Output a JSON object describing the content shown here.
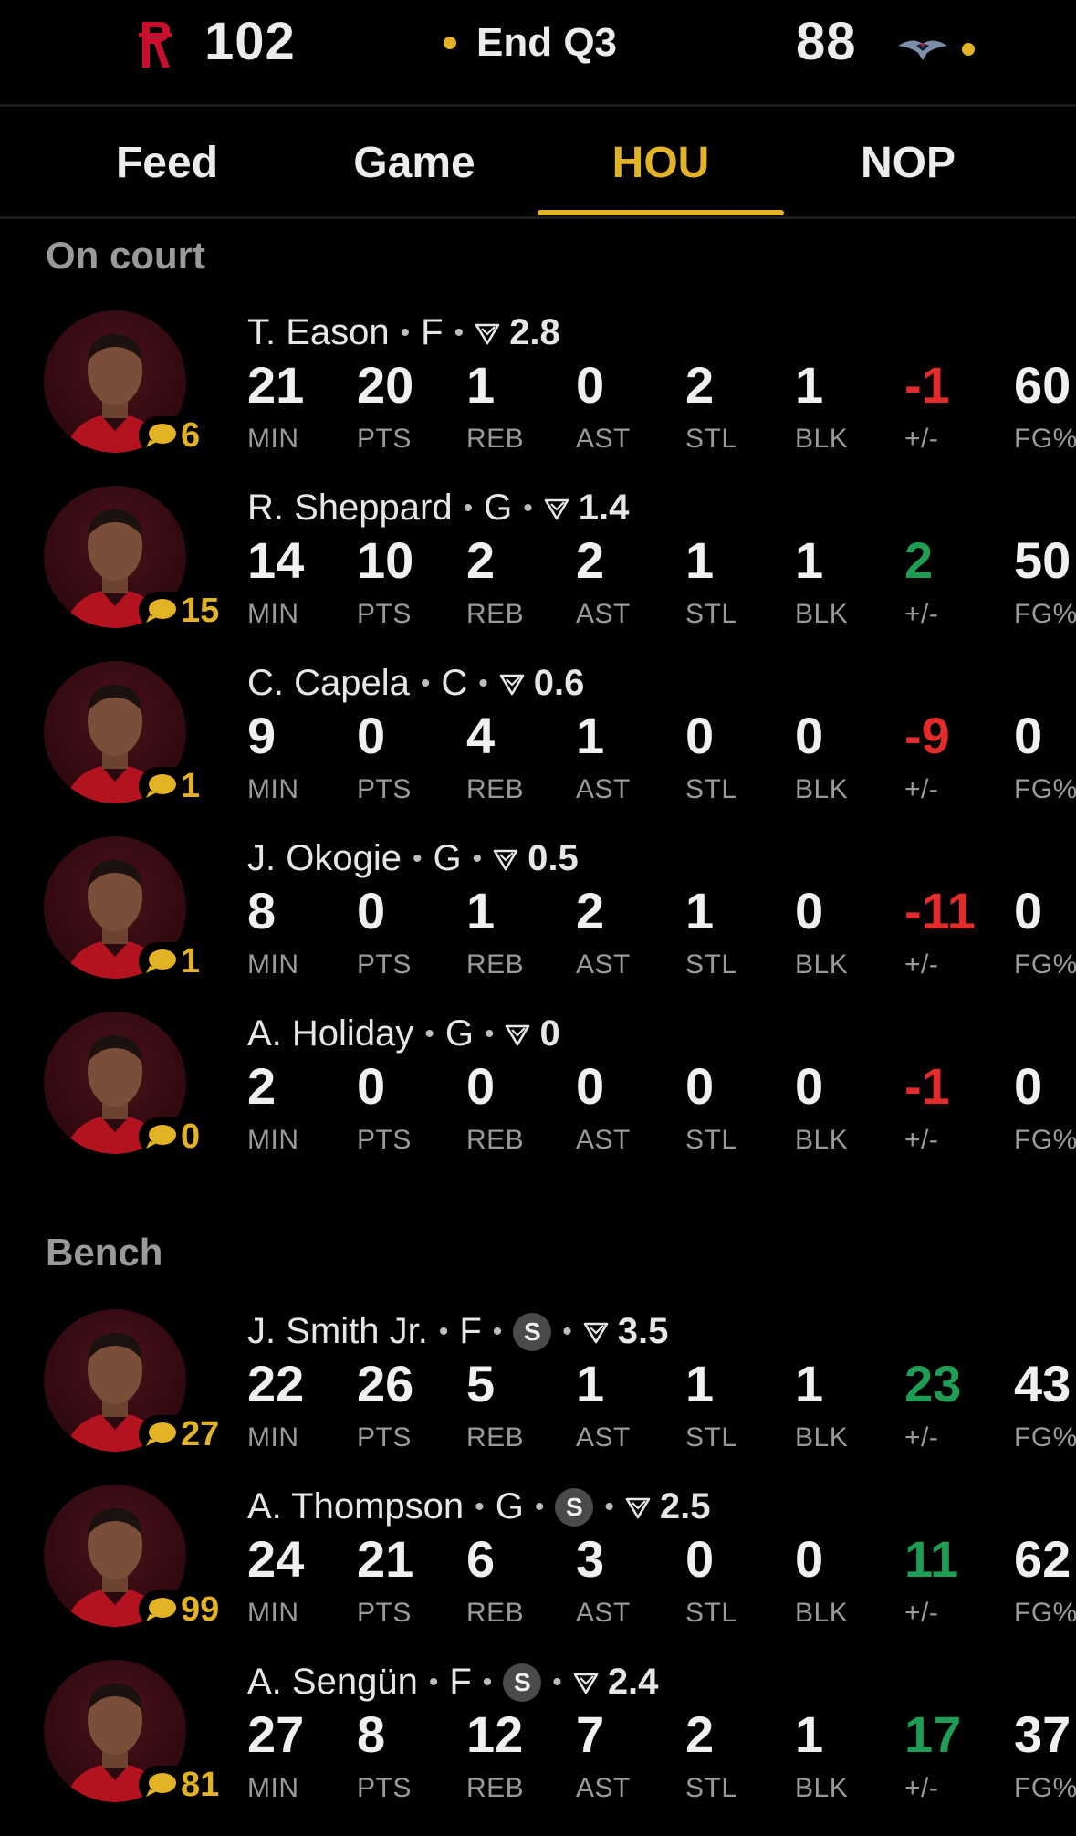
{
  "scoreboard": {
    "home_score": "102",
    "status": "End Q3",
    "away_score": "88",
    "home_logo": "rockets-logo",
    "away_logo": "pelicans-logo",
    "accent_color": "#e2b227"
  },
  "tabs": [
    {
      "label": "Feed",
      "active": false
    },
    {
      "label": "Game",
      "active": false
    },
    {
      "label": "HOU",
      "active": true
    },
    {
      "label": "NOP",
      "active": false
    }
  ],
  "sections": {
    "on_court": "On court",
    "bench": "Bench"
  },
  "stat_labels": [
    "MIN",
    "PTS",
    "REB",
    "AST",
    "STL",
    "BLK",
    "+/-",
    "FG%"
  ],
  "on_court": [
    {
      "name": "T. Eason",
      "position": "F",
      "rating": "2.8",
      "starter": false,
      "comments": "6",
      "stats": [
        "21",
        "20",
        "1",
        "0",
        "2",
        "1",
        "-1",
        "60"
      ],
      "plus_minus_sign": "neg"
    },
    {
      "name": "R. Sheppard",
      "position": "G",
      "rating": "1.4",
      "starter": false,
      "comments": "15",
      "stats": [
        "14",
        "10",
        "2",
        "2",
        "1",
        "1",
        "2",
        "50"
      ],
      "plus_minus_sign": "pos"
    },
    {
      "name": "C. Capela",
      "position": "C",
      "rating": "0.6",
      "starter": false,
      "comments": "1",
      "stats": [
        "9",
        "0",
        "4",
        "1",
        "0",
        "0",
        "-9",
        "0"
      ],
      "plus_minus_sign": "neg"
    },
    {
      "name": "J. Okogie",
      "position": "G",
      "rating": "0.5",
      "starter": false,
      "comments": "1",
      "stats": [
        "8",
        "0",
        "1",
        "2",
        "1",
        "0",
        "-11",
        "0"
      ],
      "plus_minus_sign": "neg"
    },
    {
      "name": "A. Holiday",
      "position": "G",
      "rating": "0",
      "starter": false,
      "comments": "0",
      "stats": [
        "2",
        "0",
        "0",
        "0",
        "0",
        "0",
        "-1",
        "0"
      ],
      "plus_minus_sign": "neg"
    }
  ],
  "bench": [
    {
      "name": "J. Smith Jr.",
      "position": "F",
      "rating": "3.5",
      "starter": true,
      "starter_badge": "S",
      "comments": "27",
      "stats": [
        "22",
        "26",
        "5",
        "1",
        "1",
        "1",
        "23",
        "43"
      ],
      "plus_minus_sign": "pos"
    },
    {
      "name": "A. Thompson",
      "position": "G",
      "rating": "2.5",
      "starter": true,
      "starter_badge": "S",
      "comments": "99",
      "stats": [
        "24",
        "21",
        "6",
        "3",
        "0",
        "0",
        "11",
        "62"
      ],
      "plus_minus_sign": "pos"
    },
    {
      "name": "A. Sengün",
      "position": "F",
      "rating": "2.4",
      "starter": true,
      "starter_badge": "S",
      "comments": "81",
      "stats": [
        "27",
        "8",
        "12",
        "7",
        "2",
        "1",
        "17",
        "37"
      ],
      "plus_minus_sign": "pos"
    }
  ]
}
